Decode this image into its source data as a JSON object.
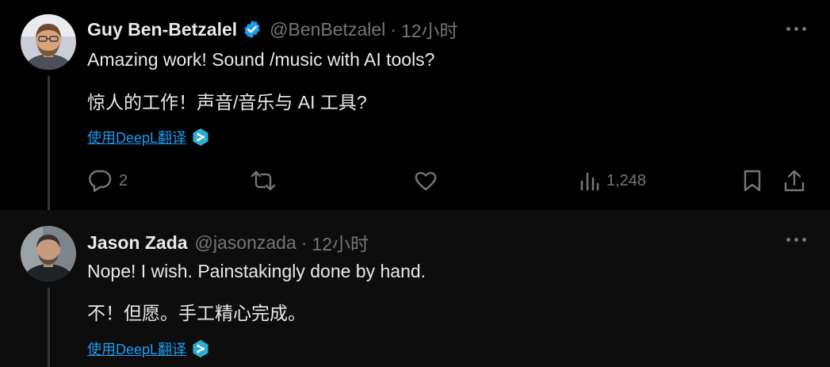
{
  "tweets": [
    {
      "name": "Guy Ben-Betzalel",
      "handle": "@BenBetzalel",
      "separator": "·",
      "time": "12小时",
      "verified": true,
      "text": "Amazing work! Sound /music with AI tools?",
      "translation": "惊人的工作！声音/音乐与 AI 工具?",
      "translate_link": "使用DeepL翻译",
      "reply_count": "2",
      "view_count": "1,248"
    },
    {
      "name": "Jason Zada",
      "handle": "@jasonzada",
      "separator": "·",
      "time": "12小时",
      "verified": false,
      "text": "Nope! I wish. Painstakingly done by hand.",
      "translation": "不！但愿。手工精心完成。",
      "translate_link": "使用DeepL翻译"
    }
  ],
  "icons": {
    "verified": "verified-badge-icon",
    "more": "more-icon",
    "deepl": "deepl-icon",
    "reply": "reply-icon",
    "retweet": "retweet-icon",
    "like": "like-icon",
    "views": "views-icon",
    "bookmark": "bookmark-icon",
    "share": "share-icon"
  },
  "colors": {
    "background": "#000000",
    "reply_background": "#0d0d0d",
    "text": "#e7e9ea",
    "muted": "#71767b",
    "link": "#1d9bf0",
    "verified": "#1d9bf0",
    "deepl": "#2faed4"
  }
}
